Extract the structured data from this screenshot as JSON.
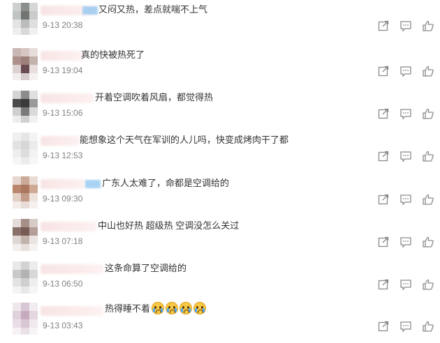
{
  "comments": [
    {
      "text": "又闷又热，差点就喘不上气",
      "time": "9-13 20:38",
      "emoji_count": 0
    },
    {
      "text": "真的快被热死了",
      "time": "9-13 19:04",
      "emoji_count": 0
    },
    {
      "text": "开着空调吹着风扇，都觉得热",
      "time": "9-13 15:06",
      "emoji_count": 0
    },
    {
      "text": "能想象这个天气在军训的人儿吗，快变成烤肉干了都",
      "time": "9-13 12:53",
      "emoji_count": 0
    },
    {
      "text": "广东人太难了，命都是空调给的",
      "time": "9-13 09:30",
      "emoji_count": 0
    },
    {
      "text": "中山也好热 超级热 空调没怎么关过",
      "time": "9-13 07:18",
      "emoji_count": 0
    },
    {
      "text": "这条命算了空调给的",
      "time": "9-13 06:50",
      "emoji_count": 0
    },
    {
      "text": "热得睡不着",
      "time": "9-13 03:43",
      "emoji_count": 4
    }
  ],
  "icons": {
    "share": "share-icon",
    "reply": "comment-icon",
    "like": "thumbs-up-icon"
  },
  "colors": {
    "text": "#333333",
    "time": "#808080",
    "icon": "#8a8a8a"
  }
}
